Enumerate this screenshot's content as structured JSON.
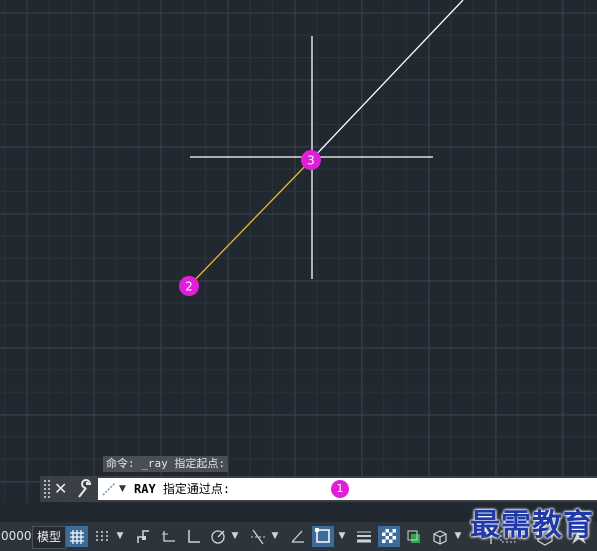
{
  "drawing": {
    "background_color": "#212830",
    "ray_color": "#ffffff",
    "rubberband_color": "#e8b830",
    "crosshair_color": "#ffffff",
    "marker_color": "#e020d8",
    "markers": [
      {
        "id": "marker-2",
        "label": "2"
      },
      {
        "id": "marker-3",
        "label": "3"
      }
    ]
  },
  "command_history": {
    "text": "命令: _ray 指定起点:"
  },
  "command_line": {
    "command": "RAY",
    "prompt": "指定通过点:",
    "marker_label": "1"
  },
  "status_bar": {
    "coordinates": "0000",
    "model_tab": "模型",
    "buttons": [
      "grid-icon",
      "snap-icon",
      "infer-icon",
      "dynamic-ucs-icon",
      "ortho-icon",
      "polar-icon",
      "object-snap-tracking-icon",
      "angle-icon",
      "object-snap-icon",
      "lineweight-icon",
      "transparency-icon",
      "selection-cycling-icon",
      "3d-object-snap-icon",
      "annotation-scale-icon",
      "workspace-icon",
      "isolate-icon"
    ],
    "active_buttons": [
      "grid-icon",
      "object-snap-icon",
      "transparency-icon"
    ]
  },
  "watermark": {
    "text": "最需教育"
  }
}
